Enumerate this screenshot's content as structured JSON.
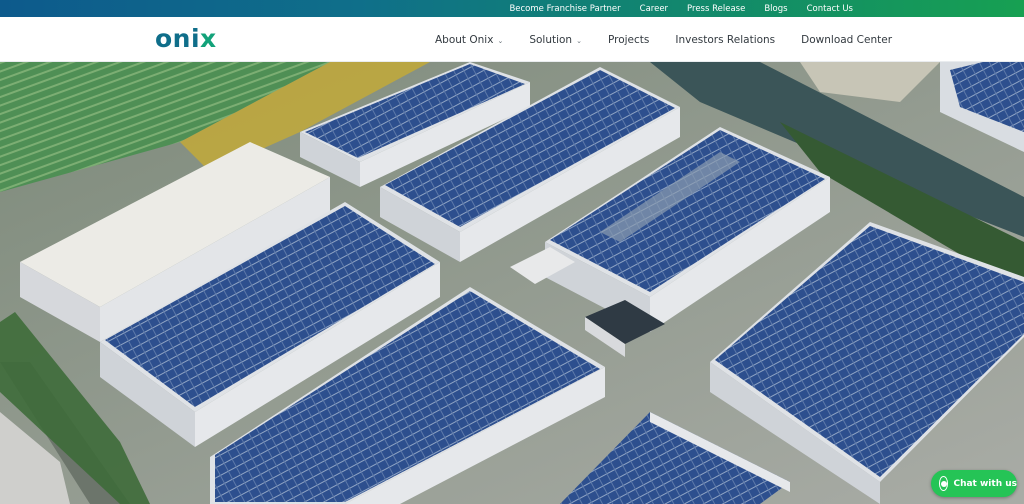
{
  "topbar": {
    "links": [
      "Become Franchise Partner",
      "Career",
      "Press Release",
      "Blogs",
      "Contact Us"
    ]
  },
  "header": {
    "logo_text_main": "oni",
    "logo_text_accent": "x",
    "nav": [
      {
        "label": "About Onix",
        "has_dropdown": true
      },
      {
        "label": "Solution",
        "has_dropdown": true
      },
      {
        "label": "Projects",
        "has_dropdown": false
      },
      {
        "label": "Investors Relations",
        "has_dropdown": false
      },
      {
        "label": "Download Center",
        "has_dropdown": false
      }
    ]
  },
  "chat": {
    "label": "Chat with us",
    "icon": "whatsapp-icon"
  },
  "colors": {
    "topbar_start": "#0d5a8c",
    "topbar_end": "#17a052",
    "logo": "#0f6e8a",
    "chat": "#25c456",
    "solar_panel": "#2c4f8f"
  }
}
